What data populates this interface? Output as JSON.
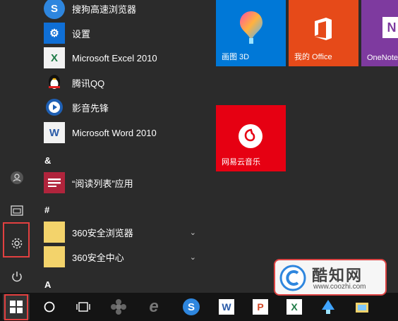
{
  "apps": [
    {
      "label": "搜狗高速浏览器",
      "icon": "sogou-browser-icon",
      "color": "#2e86de"
    },
    {
      "label": "设置",
      "icon": "gear-icon",
      "color": "#0f6fd6"
    },
    {
      "label": "Microsoft Excel 2010",
      "icon": "excel-icon",
      "color": "#1d7a45"
    },
    {
      "label": "腾讯QQ",
      "icon": "qq-penguin-icon",
      "color": "#2b2b2b"
    },
    {
      "label": "影音先锋",
      "icon": "media-player-icon",
      "color": "#1e5fb3"
    },
    {
      "label": "Microsoft Word 2010",
      "icon": "word-icon",
      "color": "#2a5ba8"
    }
  ],
  "section_amp": "&",
  "reading_app": {
    "label": "“阅读列表”应用",
    "icon": "reading-list-icon",
    "color": "#b0243c"
  },
  "section_hash": "#",
  "folders": [
    {
      "label": "360安全浏览器",
      "icon": "folder-icon",
      "color": "#f3d36b"
    },
    {
      "label": "360安全中心",
      "icon": "folder-icon",
      "color": "#f3d36b"
    }
  ],
  "section_a": "A",
  "tiles": [
    {
      "label": "画图 3D",
      "color": "#0078d7",
      "icon": "paint-3d-icon"
    },
    {
      "label": "我的 Office",
      "color": "#e64a19",
      "icon": "office-icon"
    },
    {
      "label": "OneNote",
      "color": "#7e3a9f",
      "icon": "onenote-icon"
    },
    {
      "label": "网易云音乐",
      "color": "#e60012",
      "icon": "netease-music-icon"
    }
  ],
  "watermark": {
    "title": "酷知网",
    "url": "www.coozhi.com"
  }
}
